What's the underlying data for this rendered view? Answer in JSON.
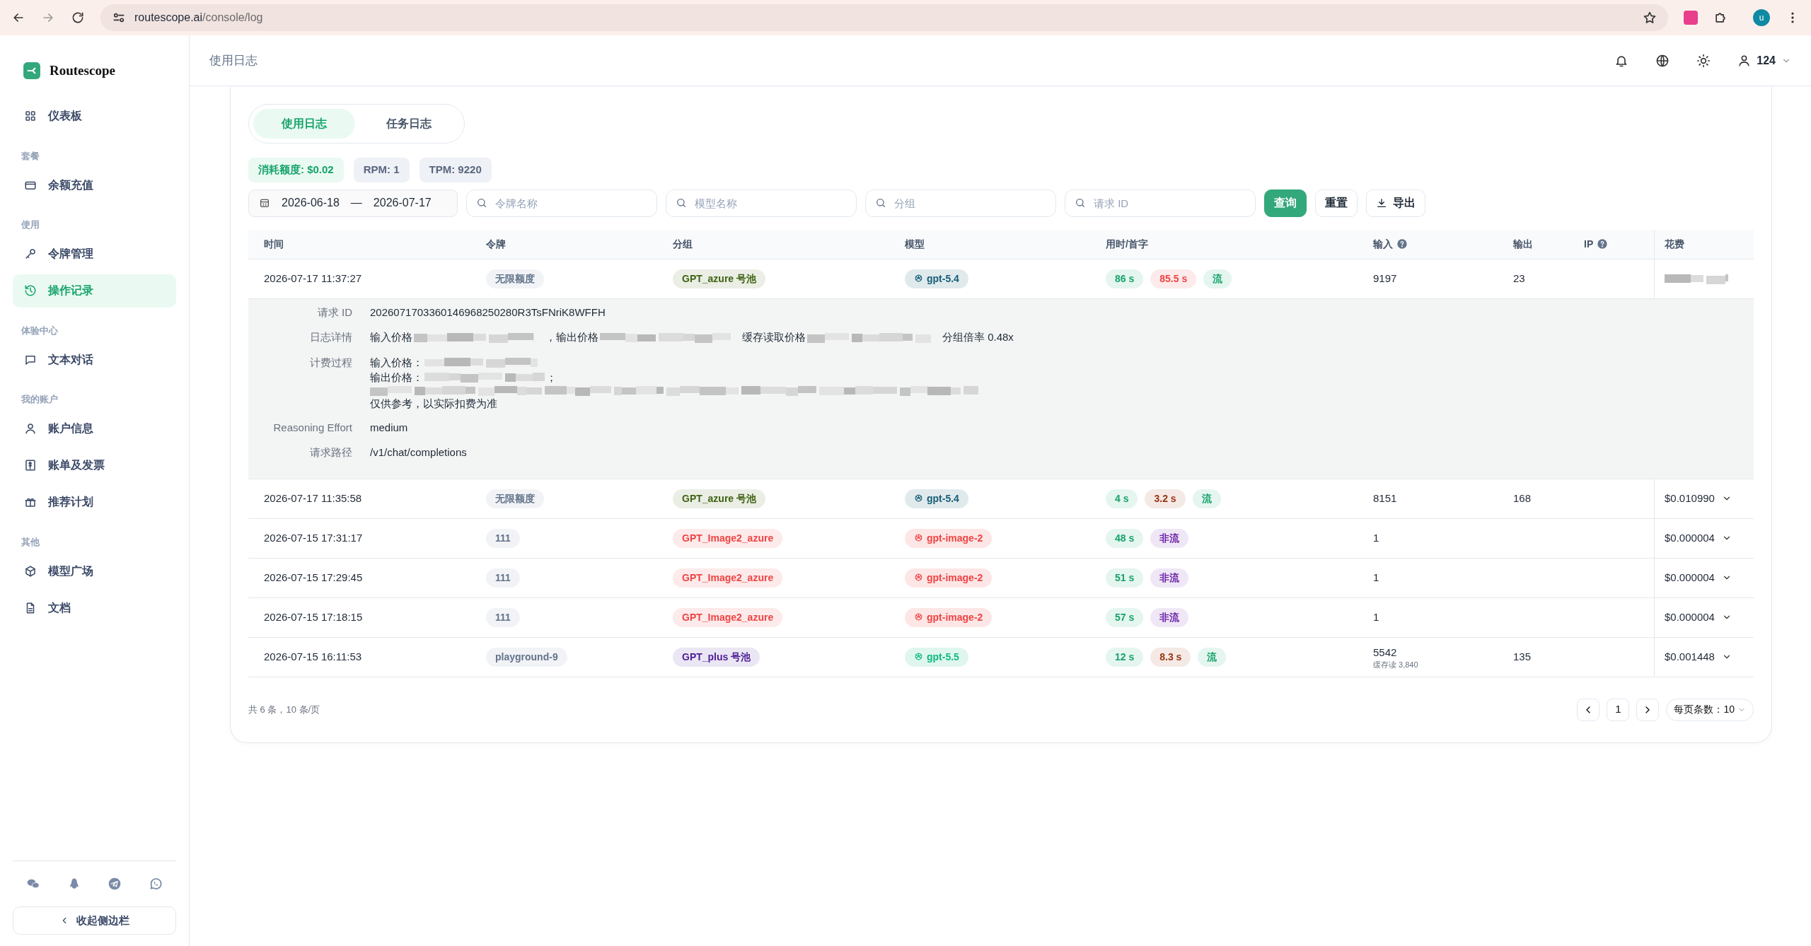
{
  "browser": {
    "url_host": "routescope.ai",
    "url_path": "/console/log",
    "avatar": "u"
  },
  "sidebar": {
    "brand": "Routescope",
    "items": [
      {
        "kind": "link",
        "label": "仪表板",
        "selected": false
      },
      {
        "kind": "section",
        "label": "套餐"
      },
      {
        "kind": "link",
        "label": "余额充值",
        "selected": false
      },
      {
        "kind": "section",
        "label": "使用"
      },
      {
        "kind": "link",
        "label": "令牌管理",
        "selected": false
      },
      {
        "kind": "link",
        "label": "操作记录",
        "selected": true
      },
      {
        "kind": "section",
        "label": "体验中心"
      },
      {
        "kind": "link",
        "label": "文本对话",
        "selected": false
      },
      {
        "kind": "section",
        "label": "我的账户"
      },
      {
        "kind": "link",
        "label": "账户信息",
        "selected": false
      },
      {
        "kind": "link",
        "label": "账单及发票",
        "selected": false
      },
      {
        "kind": "link",
        "label": "推荐计划",
        "selected": false
      },
      {
        "kind": "section",
        "label": "其他"
      },
      {
        "kind": "link",
        "label": "模型广场",
        "selected": false
      },
      {
        "kind": "link",
        "label": "文档",
        "selected": false
      }
    ],
    "collapse": "收起侧边栏"
  },
  "header": {
    "title": "使用日志",
    "user": "124"
  },
  "tabs": [
    {
      "label": "使用日志",
      "selected": true
    },
    {
      "label": "任务日志",
      "selected": false
    }
  ],
  "stats": [
    {
      "kind": "quota",
      "label": "消耗额度: $0.02"
    },
    {
      "kind": "plain",
      "label": "RPM: 1"
    },
    {
      "kind": "plain",
      "label": "TPM: 9220"
    }
  ],
  "filters": {
    "date_start": "2026-06-18",
    "date_end": "2026-07-17",
    "date_sep": "—",
    "fields": [
      {
        "placeholder": "令牌名称"
      },
      {
        "placeholder": "模型名称"
      },
      {
        "placeholder": "分组"
      },
      {
        "placeholder": "请求 ID"
      }
    ],
    "buttons": [
      {
        "kind": "primary",
        "label": "查询"
      },
      {
        "kind": "plain",
        "label": "重置"
      },
      {
        "kind": "export",
        "label": "导出"
      }
    ]
  },
  "table": {
    "columns": [
      {
        "label": "时间",
        "help": false
      },
      {
        "label": "令牌",
        "help": false
      },
      {
        "label": "分组",
        "help": false
      },
      {
        "label": "模型",
        "help": false
      },
      {
        "label": "用时/首字",
        "help": false
      },
      {
        "label": "输入",
        "help": true
      },
      {
        "label": "输出",
        "help": false
      },
      {
        "label": "IP",
        "help": true
      },
      {
        "label": "花费",
        "help": false
      }
    ],
    "rows": [
      {
        "time": "2026-07-17 11:37:27",
        "token": "无限额度",
        "group": {
          "text": "GPT_azure 号池",
          "color": "#3f6212"
        },
        "model": {
          "text": "gpt-5.4",
          "color": "#155e75"
        },
        "timing": [
          {
            "text": "86 s",
            "color": "#16a36a"
          },
          {
            "text": "85.5 s",
            "color": "#ef4444"
          },
          {
            "text": "流",
            "color": "#16a36a"
          }
        ],
        "input": "9197",
        "output": "23",
        "expanded": true,
        "detail": [
          {
            "kind": "text",
            "label": "请求 ID",
            "value": "2026071703360146968250280R3TsFNriK8WFFH"
          },
          {
            "kind": "prices",
            "label": "日志详情",
            "parts": [
              {
                "text": "输入价格",
                "masked": true
              },
              {
                "text": "，输出价格",
                "masked": true
              },
              {
                "text": "缓存读取价格",
                "masked": true
              },
              {
                "text": "分组倍率 0.48x",
                "masked": false
              }
            ]
          },
          {
            "kind": "billing",
            "label": "计费过程",
            "lines": [
              {
                "kind": "masked",
                "text": "输入价格："
              },
              {
                "kind": "masked",
                "text": "输出价格：",
                "after": "；"
              },
              {
                "kind": "blur"
              },
              {
                "kind": "plain",
                "text": "仅供参考，以实际扣费为准"
              }
            ]
          },
          {
            "kind": "text",
            "label": "Reasoning Effort",
            "value": "medium"
          },
          {
            "kind": "text",
            "label": "请求路径",
            "value": "/v1/chat/completions"
          }
        ]
      },
      {
        "time": "2026-07-17 11:35:58",
        "token": "无限额度",
        "group": {
          "text": "GPT_azure 号池",
          "color": "#3f6212"
        },
        "model": {
          "text": "gpt-5.4",
          "color": "#155e75"
        },
        "timing": [
          {
            "text": "4 s",
            "color": "#16a36a"
          },
          {
            "text": "3.2 s",
            "color": "#9a3412"
          },
          {
            "text": "流",
            "color": "#16a36a"
          }
        ],
        "input": "8151",
        "output": "168",
        "cost": "$0.010990",
        "expanded": false
      },
      {
        "time": "2026-07-15 17:31:17",
        "token": "111",
        "group": {
          "text": "GPT_Image2_azure",
          "color": "#ef4444"
        },
        "model": {
          "text": "gpt-image-2",
          "color": "#ef4444"
        },
        "timing": [
          {
            "text": "48 s",
            "color": "#16a36a"
          },
          {
            "text": "非流",
            "color": "#6b21a8"
          }
        ],
        "input": "1",
        "cost": "$0.000004",
        "expanded": false
      },
      {
        "time": "2026-07-15 17:29:45",
        "token": "111",
        "group": {
          "text": "GPT_Image2_azure",
          "color": "#ef4444"
        },
        "model": {
          "text": "gpt-image-2",
          "color": "#ef4444"
        },
        "timing": [
          {
            "text": "51 s",
            "color": "#16a36a"
          },
          {
            "text": "非流",
            "color": "#6b21a8"
          }
        ],
        "input": "1",
        "cost": "$0.000004",
        "expanded": false
      },
      {
        "time": "2026-07-15 17:18:15",
        "token": "111",
        "group": {
          "text": "GPT_Image2_azure",
          "color": "#ef4444"
        },
        "model": {
          "text": "gpt-image-2",
          "color": "#ef4444"
        },
        "timing": [
          {
            "text": "57 s",
            "color": "#16a36a"
          },
          {
            "text": "非流",
            "color": "#6b21a8"
          }
        ],
        "input": "1",
        "cost": "$0.000004",
        "expanded": false
      },
      {
        "time": "2026-07-15 16:11:53",
        "token": "playground-9",
        "group": {
          "text": "GPT_plus 号池",
          "color": "#4c1d95"
        },
        "model": {
          "text": "gpt-5.5",
          "color": "#10b981"
        },
        "timing": [
          {
            "text": "12 s",
            "color": "#16a36a"
          },
          {
            "text": "8.3 s",
            "color": "#9a3412"
          },
          {
            "text": "流",
            "color": "#16a36a"
          }
        ],
        "input": "5542",
        "input_note": "缓存读 3,840",
        "output": "135",
        "cost": "$0.001448",
        "expanded": false
      }
    ]
  },
  "footer": {
    "summary": "共 6 条，10 条/页",
    "page": "1",
    "page_size": "每页条数：10"
  }
}
